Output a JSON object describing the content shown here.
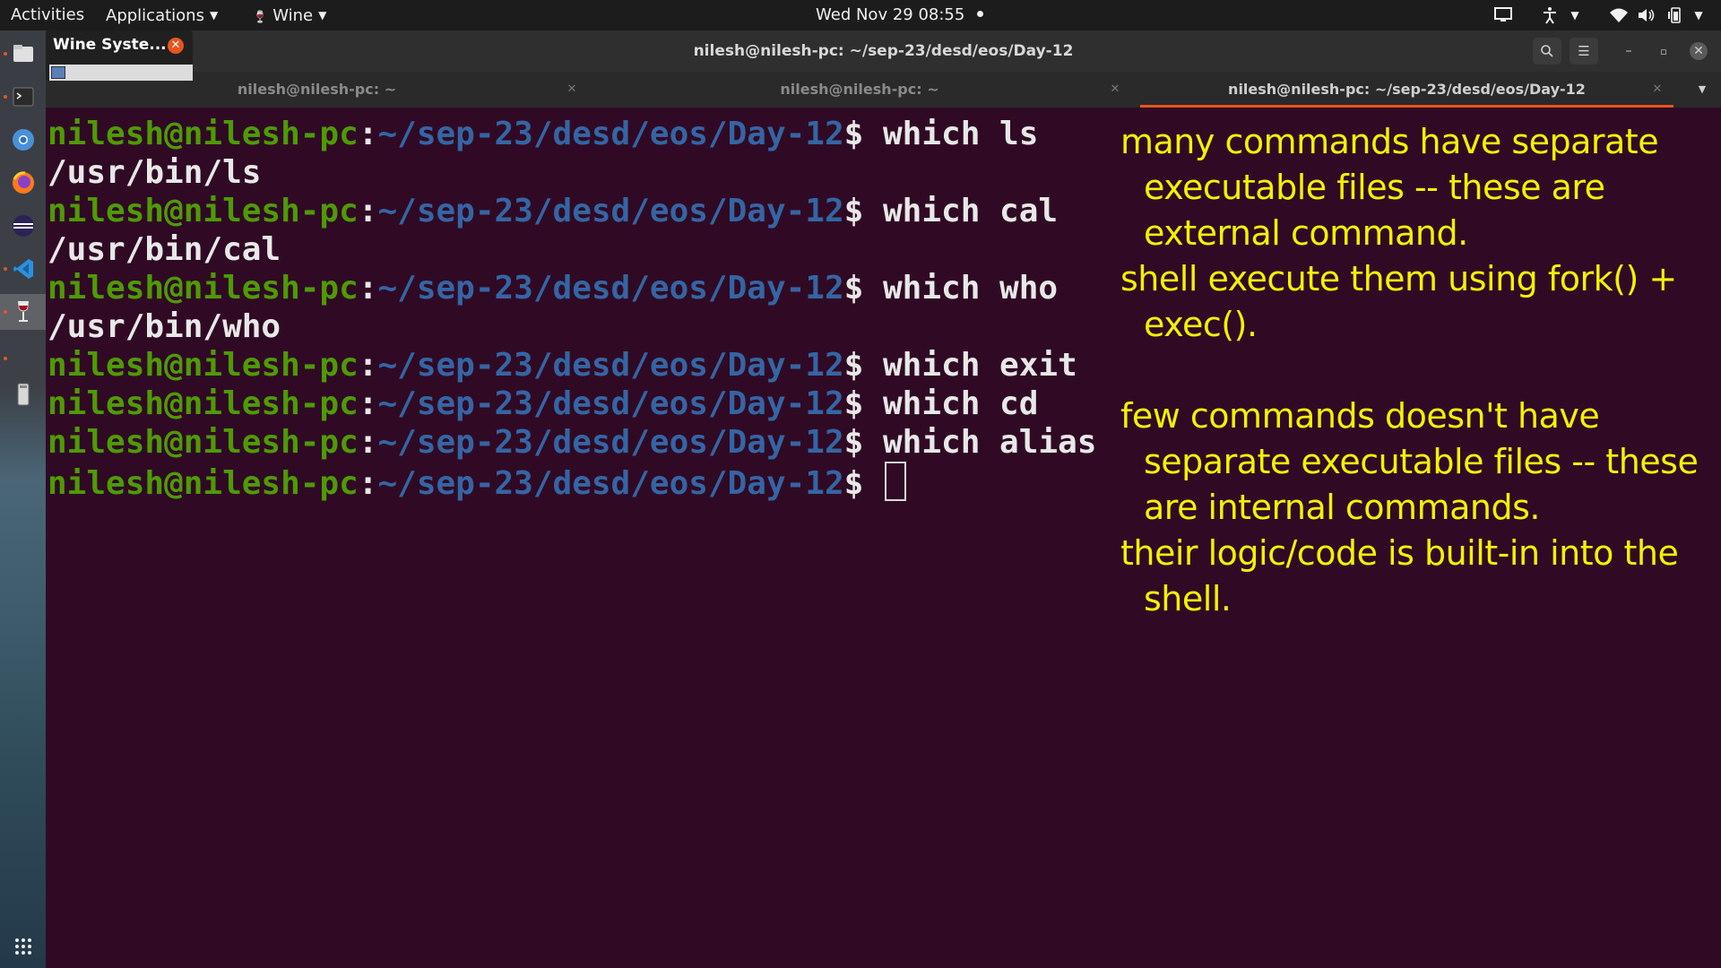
{
  "topbar": {
    "activities": "Activities",
    "applications": "Applications",
    "wine": "Wine",
    "clock": "Wed Nov 29  08:55"
  },
  "wine_popup": {
    "title": "Wine Syste..."
  },
  "window": {
    "title": "nilesh@nilesh-pc: ~/sep-23/desd/eos/Day-12"
  },
  "tabs": [
    {
      "label": "nilesh@nilesh-pc: ~"
    },
    {
      "label": "nilesh@nilesh-pc: ~"
    },
    {
      "label": "nilesh@nilesh-pc: ~/sep-23/desd/eos/Day-12"
    }
  ],
  "terminal": {
    "prompt_user": "nilesh@nilesh-pc",
    "prompt_colon": ":",
    "prompt_path": "~/sep-23/desd/eos/Day-12",
    "prompt_dollar": "$",
    "lines": [
      {
        "cmd": " which ls"
      },
      {
        "output": "/usr/bin/ls"
      },
      {
        "cmd": " which cal"
      },
      {
        "output": "/usr/bin/cal"
      },
      {
        "cmd": " which who"
      },
      {
        "output": "/usr/bin/who"
      },
      {
        "cmd": " which exit"
      },
      {
        "cmd": " which cd"
      },
      {
        "cmd": " which alias"
      }
    ]
  },
  "notes": {
    "l1": "many commands have separate",
    "l2": "executable files -- these are",
    "l3": "external command.",
    "l4": "shell execute them using fork() +",
    "l5": "exec().",
    "l6": "few commands doesn't have",
    "l7": "separate executable files -- these",
    "l8": "are internal commands.",
    "l9": "their logic/code is built-in into the",
    "l10": "shell."
  },
  "colors": {
    "terminal_bg": "#300a24",
    "prompt_user": "#4e9a06",
    "prompt_path": "#3465a4",
    "notes_text": "#f2f200",
    "accent": "#e95420"
  },
  "icons": {
    "dock": [
      "files-icon",
      "terminal-icon",
      "chrome-icon",
      "firefox-icon",
      "eclipse-icon",
      "vscode-icon",
      "wine-glass-icon",
      "usb-drive-icon",
      "app-grid-icon"
    ],
    "system": [
      "screen-icon",
      "accessibility-icon",
      "wifi-icon",
      "volume-icon",
      "battery-icon"
    ]
  }
}
